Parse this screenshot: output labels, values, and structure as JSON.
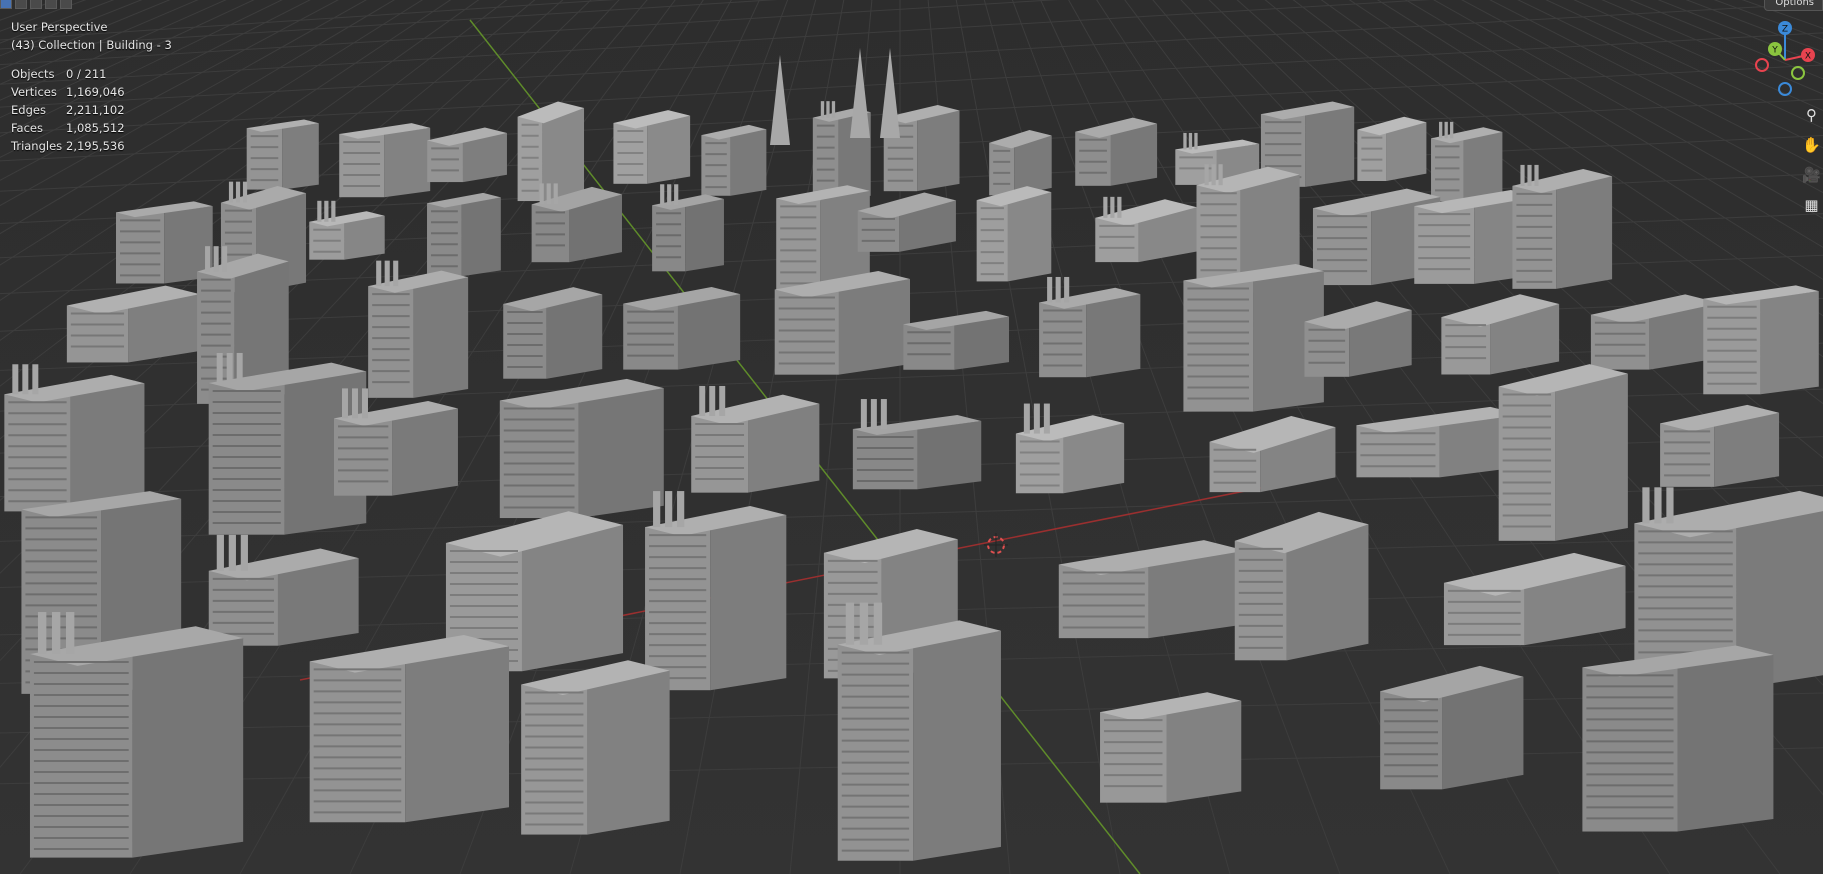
{
  "viewport": {
    "view_name": "User Perspective",
    "collection_line": "(43) Collection | Building - 3",
    "stats": [
      {
        "label": "Objects",
        "value": "0 / 211"
      },
      {
        "label": "Vertices",
        "value": "1,169,046"
      },
      {
        "label": "Edges",
        "value": "2,211,102"
      },
      {
        "label": "Faces",
        "value": "1,085,512"
      },
      {
        "label": "Triangles",
        "value": "2,195,536"
      }
    ]
  },
  "header": {
    "options_label": "Options"
  },
  "gizmo": {
    "x_label": "X",
    "y_label": "Y",
    "z_label": "Z",
    "x_color": "#e8434f",
    "y_color": "#8bc53f",
    "z_color": "#3b8ad9"
  },
  "nav": [
    {
      "name": "zoom-icon",
      "glyph": "⚲"
    },
    {
      "name": "pan-hand-icon",
      "glyph": "✋"
    },
    {
      "name": "camera-icon",
      "glyph": "🎥"
    },
    {
      "name": "grid-toggle-icon",
      "glyph": "▦"
    }
  ],
  "colors": {
    "background": "#303030",
    "building": "#9a9a9a",
    "x_axis": "#b03030",
    "y_axis": "#6a9a2a"
  }
}
